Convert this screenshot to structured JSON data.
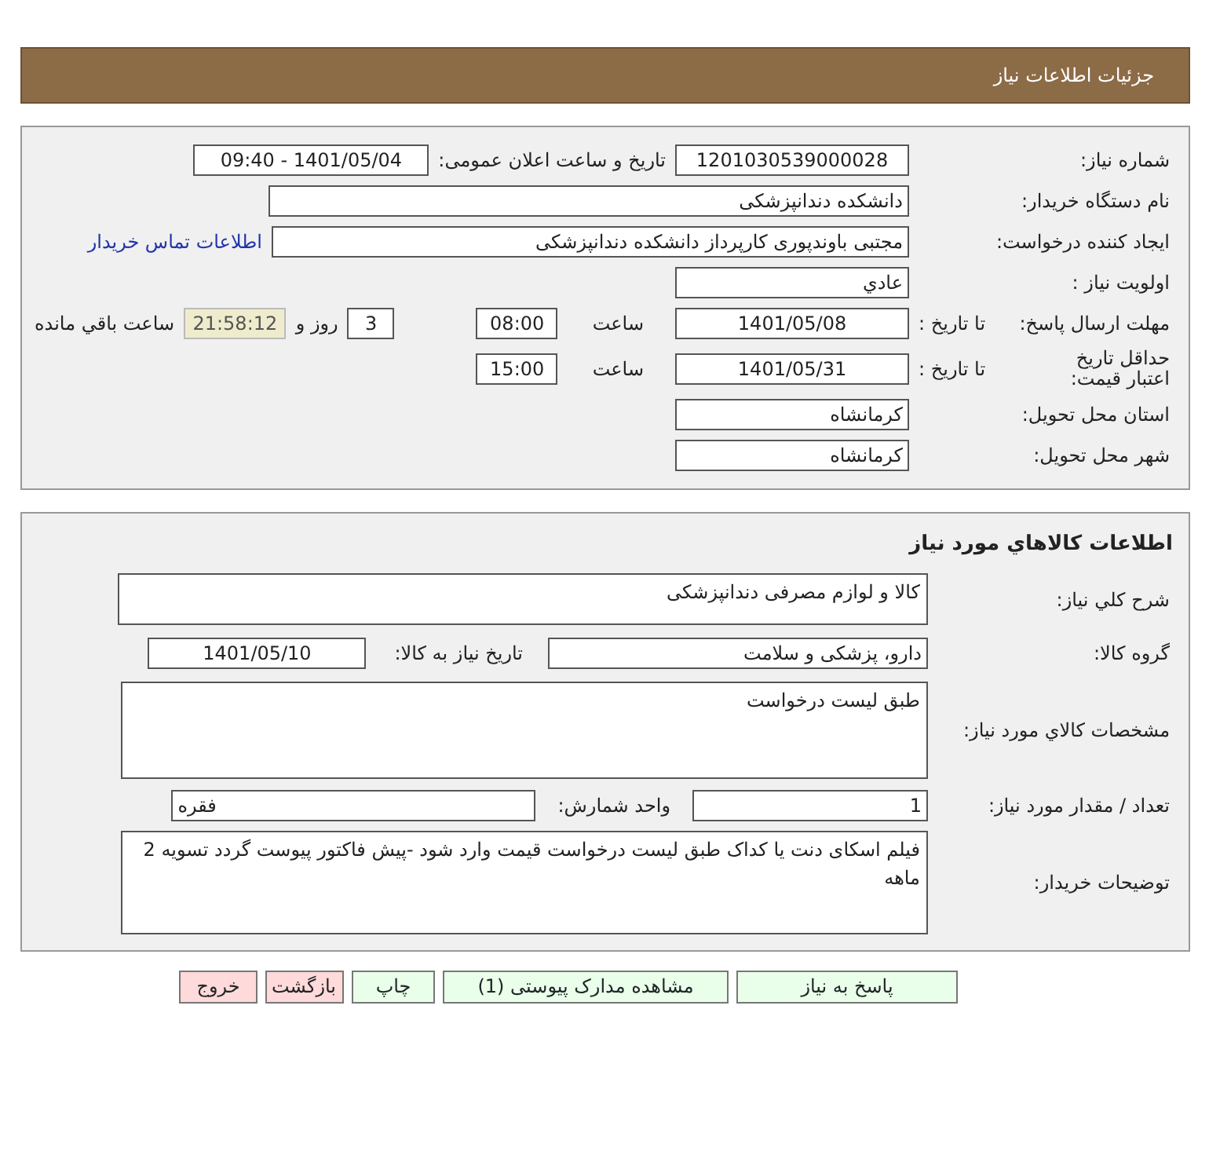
{
  "header": {
    "title": "جزئیات اطلاعات نیاز"
  },
  "general": {
    "need_number": {
      "label": "شماره نیاز:",
      "value": "1201030539000028"
    },
    "announce": {
      "label": "تاریخ و ساعت اعلان عمومی:",
      "value": "1401/05/04 - 09:40"
    },
    "buyer": {
      "label": "نام دستگاه خریدار:",
      "value": "دانشکده دندانپزشکی"
    },
    "creator": {
      "label": "ایجاد کننده درخواست:",
      "value": "مجتبی  باوندپوری کارپرداز دانشکده دندانپزشکی",
      "contact_link": "اطلاعات تماس خریدار"
    },
    "priority": {
      "label": "اولویت نیاز :",
      "value": "عادي"
    },
    "response_deadline": {
      "label": "مهلت ارسال پاسخ:",
      "to_label": "تا تاریخ :",
      "date": "1401/05/08",
      "time_label": "ساعت",
      "time": "08:00",
      "days": "3",
      "days_label": "روز و",
      "remaining": "21:58:12",
      "remaining_label": "ساعت باقي مانده"
    },
    "price_validity": {
      "label": "حداقل تاریخ اعتبار قیمت:",
      "to_label": "تا تاریخ :",
      "date": "1401/05/31",
      "time_label": "ساعت",
      "time": "15:00"
    },
    "province": {
      "label": "استان محل تحویل:",
      "value": "کرمانشاه"
    },
    "city": {
      "label": "شهر محل تحویل:",
      "value": "کرمانشاه"
    }
  },
  "goods": {
    "title": "اطلاعات کالاهاي مورد نياز",
    "description": {
      "label": "شرح کلي نياز:",
      "value": "کالا و لوازم مصرفی دندانپزشکی"
    },
    "group": {
      "label": "گروه کالا:",
      "value": "دارو، پزشکی و سلامت",
      "date_label": "تاریخ نیاز به کالا:",
      "date": "1401/05/10"
    },
    "specs": {
      "label": "مشخصات کالاي مورد نياز:",
      "value": "طبق لیست درخواست"
    },
    "quantity": {
      "label": "تعداد / مقدار مورد نیاز:",
      "value": "1",
      "unit_label": "واحد شمارش:",
      "unit": "فقره"
    },
    "buyer_notes": {
      "label": "توضیحات خریدار:",
      "value": "فیلم اسکای دنت یا کداک طبق لیست درخواست قیمت وارد شود -پیش فاکتور پیوست گردد تسویه 2 ماهه"
    }
  },
  "buttons": [
    {
      "label": "پاسخ به نیاز",
      "kind": "action"
    },
    {
      "label": "مشاهده مدارک پیوستی (1)",
      "kind": "action"
    },
    {
      "label": "چاپ",
      "kind": "action"
    },
    {
      "label": "بازگشت",
      "kind": "nav"
    },
    {
      "label": "خروج",
      "kind": "nav"
    }
  ]
}
